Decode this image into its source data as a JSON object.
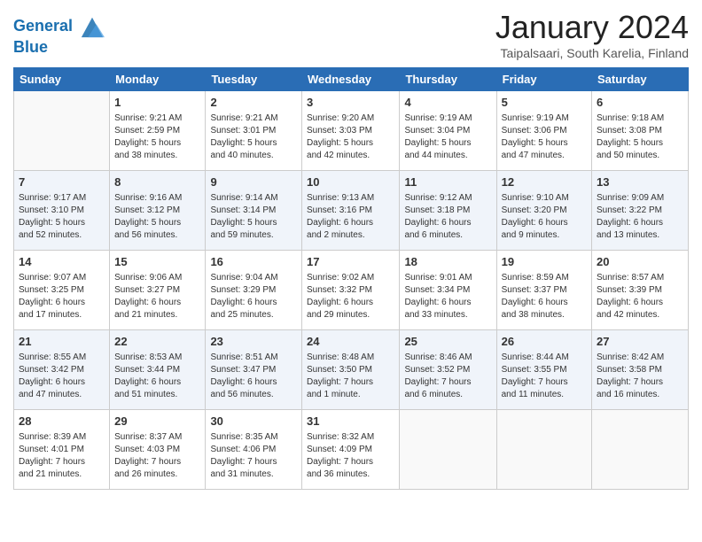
{
  "header": {
    "logo_line1": "General",
    "logo_line2": "Blue",
    "month_title": "January 2024",
    "location": "Taipalsaari, South Karelia, Finland"
  },
  "days_of_week": [
    "Sunday",
    "Monday",
    "Tuesday",
    "Wednesday",
    "Thursday",
    "Friday",
    "Saturday"
  ],
  "weeks": [
    [
      {
        "day": "",
        "info": ""
      },
      {
        "day": "1",
        "info": "Sunrise: 9:21 AM\nSunset: 2:59 PM\nDaylight: 5 hours\nand 38 minutes."
      },
      {
        "day": "2",
        "info": "Sunrise: 9:21 AM\nSunset: 3:01 PM\nDaylight: 5 hours\nand 40 minutes."
      },
      {
        "day": "3",
        "info": "Sunrise: 9:20 AM\nSunset: 3:03 PM\nDaylight: 5 hours\nand 42 minutes."
      },
      {
        "day": "4",
        "info": "Sunrise: 9:19 AM\nSunset: 3:04 PM\nDaylight: 5 hours\nand 44 minutes."
      },
      {
        "day": "5",
        "info": "Sunrise: 9:19 AM\nSunset: 3:06 PM\nDaylight: 5 hours\nand 47 minutes."
      },
      {
        "day": "6",
        "info": "Sunrise: 9:18 AM\nSunset: 3:08 PM\nDaylight: 5 hours\nand 50 minutes."
      }
    ],
    [
      {
        "day": "7",
        "info": "Sunrise: 9:17 AM\nSunset: 3:10 PM\nDaylight: 5 hours\nand 52 minutes."
      },
      {
        "day": "8",
        "info": "Sunrise: 9:16 AM\nSunset: 3:12 PM\nDaylight: 5 hours\nand 56 minutes."
      },
      {
        "day": "9",
        "info": "Sunrise: 9:14 AM\nSunset: 3:14 PM\nDaylight: 5 hours\nand 59 minutes."
      },
      {
        "day": "10",
        "info": "Sunrise: 9:13 AM\nSunset: 3:16 PM\nDaylight: 6 hours\nand 2 minutes."
      },
      {
        "day": "11",
        "info": "Sunrise: 9:12 AM\nSunset: 3:18 PM\nDaylight: 6 hours\nand 6 minutes."
      },
      {
        "day": "12",
        "info": "Sunrise: 9:10 AM\nSunset: 3:20 PM\nDaylight: 6 hours\nand 9 minutes."
      },
      {
        "day": "13",
        "info": "Sunrise: 9:09 AM\nSunset: 3:22 PM\nDaylight: 6 hours\nand 13 minutes."
      }
    ],
    [
      {
        "day": "14",
        "info": "Sunrise: 9:07 AM\nSunset: 3:25 PM\nDaylight: 6 hours\nand 17 minutes."
      },
      {
        "day": "15",
        "info": "Sunrise: 9:06 AM\nSunset: 3:27 PM\nDaylight: 6 hours\nand 21 minutes."
      },
      {
        "day": "16",
        "info": "Sunrise: 9:04 AM\nSunset: 3:29 PM\nDaylight: 6 hours\nand 25 minutes."
      },
      {
        "day": "17",
        "info": "Sunrise: 9:02 AM\nSunset: 3:32 PM\nDaylight: 6 hours\nand 29 minutes."
      },
      {
        "day": "18",
        "info": "Sunrise: 9:01 AM\nSunset: 3:34 PM\nDaylight: 6 hours\nand 33 minutes."
      },
      {
        "day": "19",
        "info": "Sunrise: 8:59 AM\nSunset: 3:37 PM\nDaylight: 6 hours\nand 38 minutes."
      },
      {
        "day": "20",
        "info": "Sunrise: 8:57 AM\nSunset: 3:39 PM\nDaylight: 6 hours\nand 42 minutes."
      }
    ],
    [
      {
        "day": "21",
        "info": "Sunrise: 8:55 AM\nSunset: 3:42 PM\nDaylight: 6 hours\nand 47 minutes."
      },
      {
        "day": "22",
        "info": "Sunrise: 8:53 AM\nSunset: 3:44 PM\nDaylight: 6 hours\nand 51 minutes."
      },
      {
        "day": "23",
        "info": "Sunrise: 8:51 AM\nSunset: 3:47 PM\nDaylight: 6 hours\nand 56 minutes."
      },
      {
        "day": "24",
        "info": "Sunrise: 8:48 AM\nSunset: 3:50 PM\nDaylight: 7 hours\nand 1 minute."
      },
      {
        "day": "25",
        "info": "Sunrise: 8:46 AM\nSunset: 3:52 PM\nDaylight: 7 hours\nand 6 minutes."
      },
      {
        "day": "26",
        "info": "Sunrise: 8:44 AM\nSunset: 3:55 PM\nDaylight: 7 hours\nand 11 minutes."
      },
      {
        "day": "27",
        "info": "Sunrise: 8:42 AM\nSunset: 3:58 PM\nDaylight: 7 hours\nand 16 minutes."
      }
    ],
    [
      {
        "day": "28",
        "info": "Sunrise: 8:39 AM\nSunset: 4:01 PM\nDaylight: 7 hours\nand 21 minutes."
      },
      {
        "day": "29",
        "info": "Sunrise: 8:37 AM\nSunset: 4:03 PM\nDaylight: 7 hours\nand 26 minutes."
      },
      {
        "day": "30",
        "info": "Sunrise: 8:35 AM\nSunset: 4:06 PM\nDaylight: 7 hours\nand 31 minutes."
      },
      {
        "day": "31",
        "info": "Sunrise: 8:32 AM\nSunset: 4:09 PM\nDaylight: 7 hours\nand 36 minutes."
      },
      {
        "day": "",
        "info": ""
      },
      {
        "day": "",
        "info": ""
      },
      {
        "day": "",
        "info": ""
      }
    ]
  ]
}
